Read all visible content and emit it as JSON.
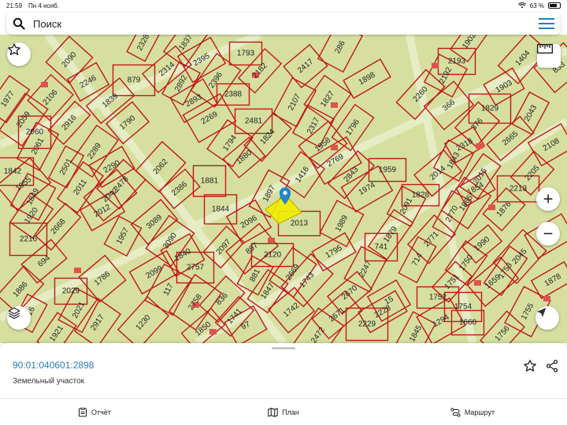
{
  "status_bar": {
    "time": "21:59",
    "date": "Пн 4 нояб.",
    "battery": "63 %",
    "battery_level": 0.63
  },
  "search": {
    "placeholder": "Поиск",
    "search_icon": "search-icon",
    "menu_icon": "hamburger-menu-icon"
  },
  "map": {
    "background": "#d6df9f",
    "parcel_line_color": "#c0171a",
    "selected_parcel_color": "#f2ee00",
    "marker_color": "#1e88c9",
    "parcel_labels": [
      "2328",
      "1837",
      "2090",
      "2314",
      "2395",
      "1793",
      "286",
      "1902",
      "1404",
      "833",
      "2246",
      "879",
      "2892",
      "2396",
      "2182",
      "2417",
      "1898",
      "2193",
      "2192",
      "1977",
      "2106",
      "1839",
      "2893",
      "2388",
      "2107",
      "1827",
      "2260",
      "366",
      "1903",
      "1829",
      "2043",
      "2059",
      "2916",
      "1790",
      "2269",
      "2481",
      "2317",
      "1796",
      "376",
      "2665",
      "2108",
      "2060",
      "2061",
      "1794",
      "1824",
      "1958",
      "2318",
      "1842",
      "2501",
      "2289",
      "2062",
      "1880",
      "2769",
      "1959",
      "1843",
      "2015",
      "2205",
      "1955",
      "2290",
      "1881",
      "1897",
      "1416",
      "2843",
      "2014",
      "1854",
      "2213",
      "1849",
      "2011",
      "2478",
      "2386",
      "1974",
      "1828",
      "2091",
      "1865",
      "1876",
      "2042",
      "2012",
      "1844",
      "2770",
      "1920",
      "2668",
      "3089",
      "2096",
      "2013",
      "1989",
      "1879",
      "2771",
      "1990",
      "1797",
      "2216",
      "1957",
      "3090",
      "2097",
      "897",
      "1795",
      "741",
      "714",
      "1750",
      "2045",
      "694",
      "1840",
      "2120",
      "2247",
      "1753",
      "1886",
      "1786",
      "2099",
      "2757",
      "881",
      "2669",
      "1751",
      "1659",
      "1878",
      "2029",
      "117",
      "1847",
      "1743",
      "2670",
      "15",
      "1752",
      "2021",
      "2758",
      "836",
      "1742",
      "2228",
      "1754",
      "916",
      "2917",
      "1741",
      "2671",
      "1294",
      "1660",
      "1755",
      "1921",
      "1230",
      "1850",
      "97",
      "2229",
      "1845",
      "2472",
      "1756"
    ],
    "selected_marker_icon": "location-pin-icon"
  },
  "controls": {
    "favorite_icon": "star-outline-icon",
    "ruler_icon": "ruler-icon",
    "zoom_in_label": "+",
    "zoom_out_label": "−",
    "layers_icon": "layers-icon",
    "locate_icon": "navigation-arrow-icon"
  },
  "sheet": {
    "cadastral_number": "90:01:040601:2898",
    "parcel_type": "Земельный участок",
    "favorite_icon": "star-outline-icon",
    "share_icon": "share-icon"
  },
  "tabs": [
    {
      "label": "Отчёт",
      "icon": "report-icon"
    },
    {
      "label": "План",
      "icon": "map-plan-icon"
    },
    {
      "label": "Маршрут",
      "icon": "route-icon"
    }
  ]
}
